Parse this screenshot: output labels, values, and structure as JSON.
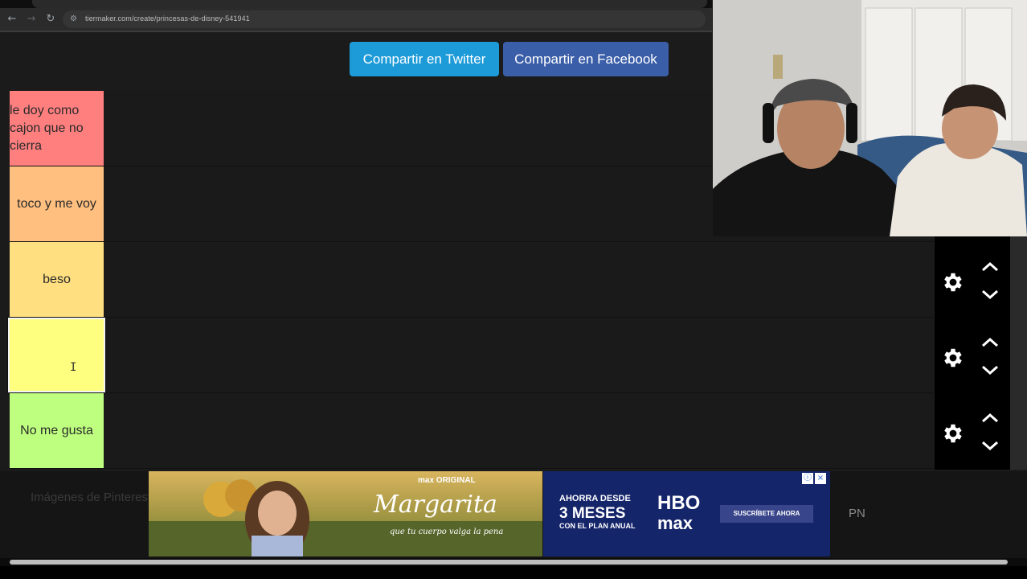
{
  "browser": {
    "url": "tiermaker.com/create/princesas-de-disney-541941"
  },
  "share": {
    "twitter_label": "Compartir en Twitter",
    "facebook_label": "Compartir en Facebook"
  },
  "tiers": [
    {
      "label": "le doy como\ncajon que no\ncierra",
      "color": "#ff7f7f"
    },
    {
      "label": "toco y me voy",
      "color": "#ffbf7f"
    },
    {
      "label": "beso",
      "color": "#ffdf7f"
    },
    {
      "label": "",
      "color": "#ffff7f"
    },
    {
      "label": "No me gusta",
      "color": "#bfff7f"
    }
  ],
  "bottom": {
    "pinterest_text": "Imágenes de Pinterest",
    "side_text": "PN",
    "ad1": {
      "brand": "max ORIGINAL",
      "title": "Margarita",
      "tagline": "que tu cuerpo valga la pena"
    },
    "ad2": {
      "line1": "AHORRA DESDE",
      "line2": "3 MESES",
      "line3": "CON EL PLAN ANUAL",
      "logo_top": "HBO",
      "logo_bottom": "max",
      "cta": "SUSCRÍBETE AHORA"
    }
  },
  "colors": {
    "twitter": "#1d9bd8",
    "facebook": "#3b5ea8",
    "background": "#1a1a1a"
  }
}
